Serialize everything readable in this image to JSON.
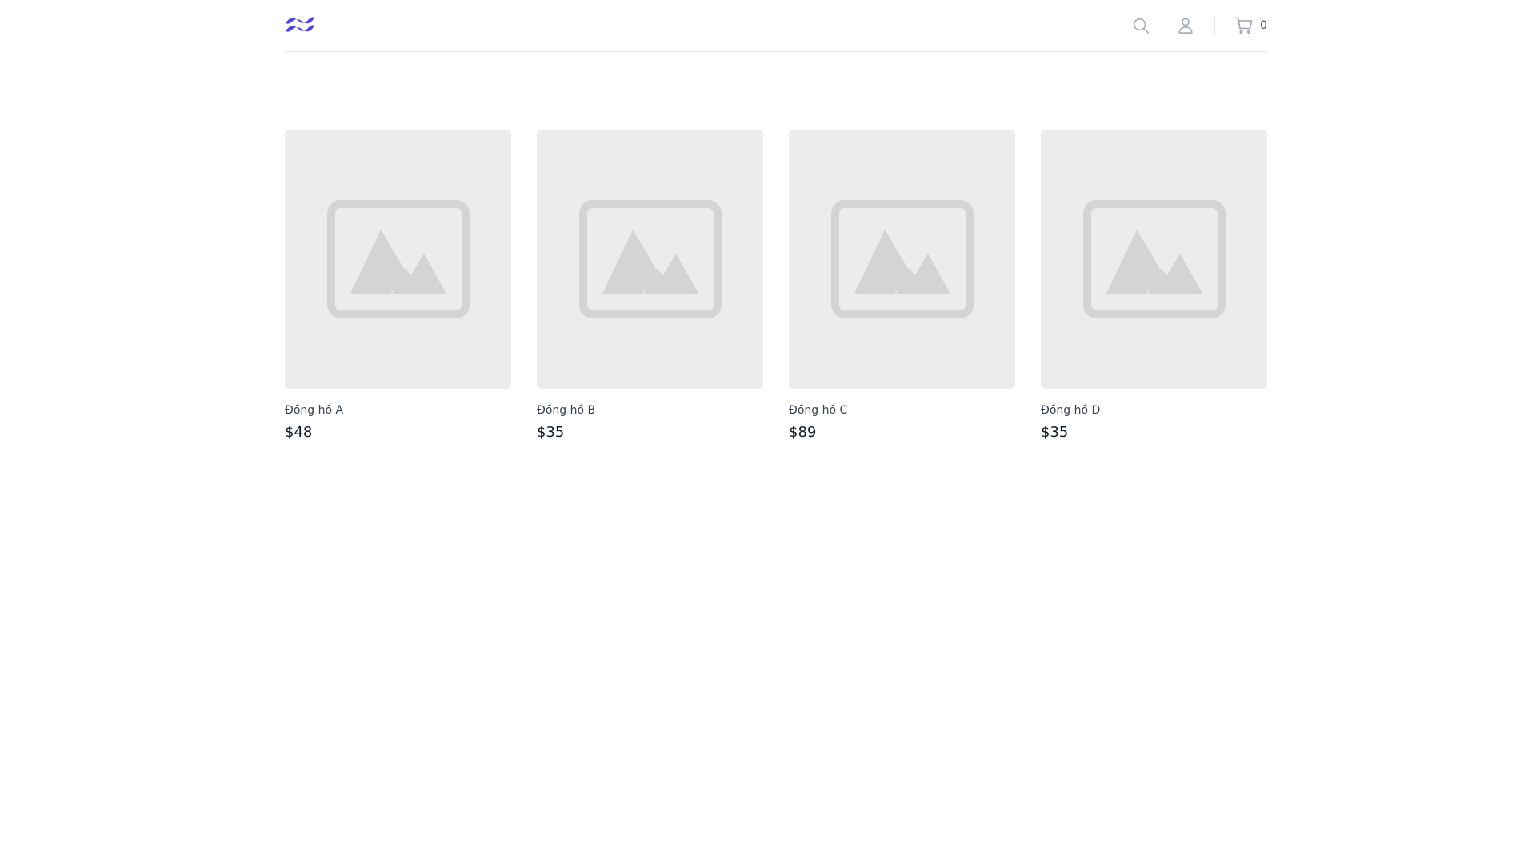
{
  "header": {
    "logo_icon": "tailwind-wave-logo",
    "search_icon": "search-icon",
    "user_icon": "user-icon",
    "cart_icon": "shopping-cart-icon",
    "cart_count": "0",
    "accent_color": "#4f46e5"
  },
  "products": [
    {
      "name": "Đồng hồ A",
      "price": "$48",
      "image_icon": "image-placeholder-icon"
    },
    {
      "name": "Đồng hồ B",
      "price": "$35",
      "image_icon": "image-placeholder-icon"
    },
    {
      "name": "Đồng hồ C",
      "price": "$89",
      "image_icon": "image-placeholder-icon"
    },
    {
      "name": "Đồng hồ D",
      "price": "$35",
      "image_icon": "image-placeholder-icon"
    }
  ]
}
